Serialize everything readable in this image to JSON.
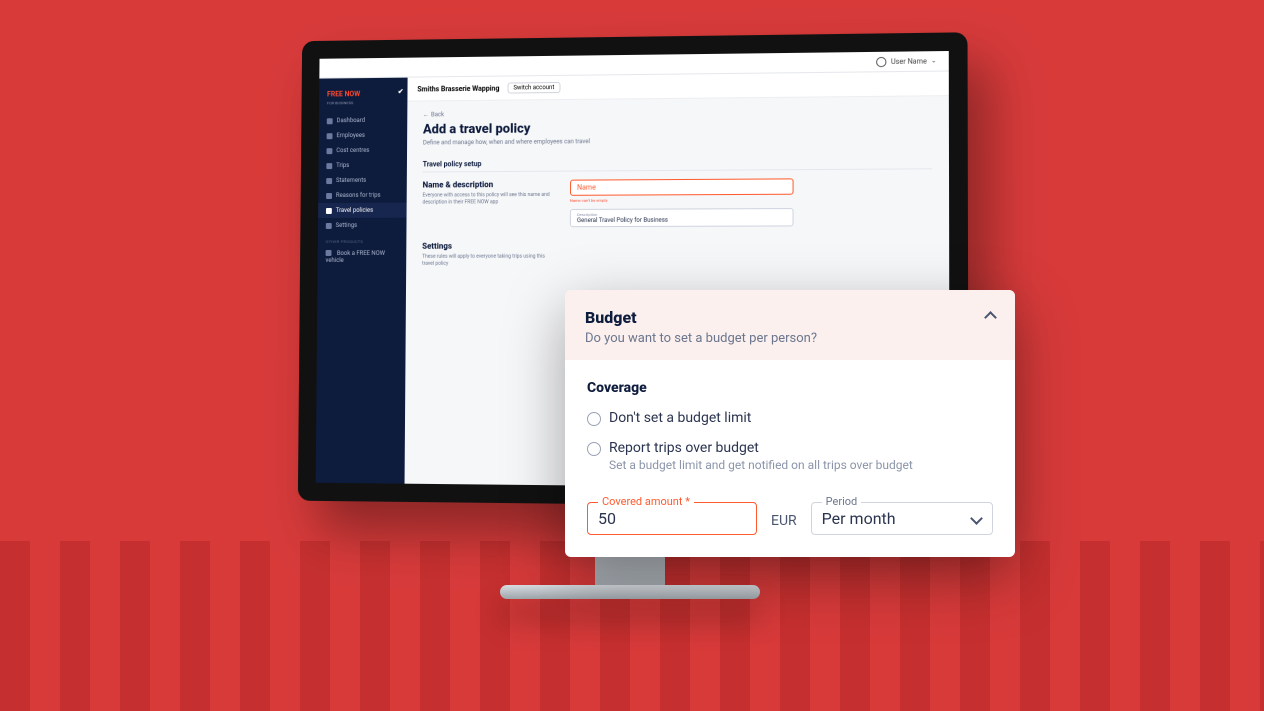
{
  "topbar": {
    "user_label": "User Name"
  },
  "brand": {
    "name": "FREE NOW",
    "sub": "FOR BUSINESS"
  },
  "sidebar": {
    "items": [
      {
        "label": "Dashboard"
      },
      {
        "label": "Employees"
      },
      {
        "label": "Cost centres"
      },
      {
        "label": "Trips"
      },
      {
        "label": "Statements"
      },
      {
        "label": "Reasons for trips"
      },
      {
        "label": "Travel policies"
      },
      {
        "label": "Settings"
      }
    ],
    "other_heading": "OTHER PRODUCTS",
    "book_label": "Book a FREE NOW vehicle"
  },
  "account": {
    "name": "Smiths Brasserie Wapping",
    "switch_label": "Switch account"
  },
  "back_label": "Back",
  "page": {
    "title": "Add a travel policy",
    "subtitle": "Define and manage how, when and where employees can travel"
  },
  "setup_heading": "Travel policy setup",
  "name_section": {
    "heading": "Name & description",
    "helper": "Everyone with access to this policy will see this name and description in their FREE NOW app",
    "name_placeholder": "Name",
    "name_error": "Name can't be empty",
    "desc_label": "Description",
    "desc_value": "General Travel Policy for Business"
  },
  "settings_section": {
    "heading": "Settings",
    "helper": "These rules will apply to everyone taking trips using this travel policy"
  },
  "budget": {
    "title": "Budget",
    "question": "Do you want to set a budget per person?",
    "coverage_heading": "Coverage",
    "opt_none": "Don't set a budget limit",
    "opt_report": "Report trips over budget",
    "opt_report_sub": "Set a budget limit and get notified on all trips over budget",
    "amount_label": "Covered amount *",
    "amount_value": "50",
    "currency": "EUR",
    "period_label": "Period",
    "period_value": "Per month"
  }
}
